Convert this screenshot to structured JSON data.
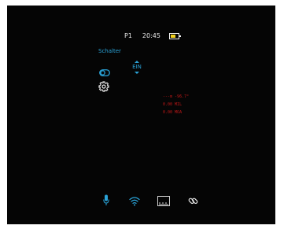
{
  "status": {
    "profile": "P1",
    "time": "20:45",
    "battery_level": 0.7,
    "battery_color": "#f3d21e"
  },
  "menu": {
    "label": "Schalter",
    "toggle_icon": "toggle-icon",
    "stepper_value": "EIN",
    "settings_icon": "gear-icon",
    "accent_color": "#2aa3d8"
  },
  "readout": {
    "line1": "---m -96.7°",
    "line2": "0.00 MIL",
    "line3": "0.00 MOA",
    "color": "#c01818"
  },
  "bottom_bar": {
    "icons": [
      "microphone-icon",
      "wifi-icon",
      "ruler-icon",
      "link-icon"
    ]
  }
}
